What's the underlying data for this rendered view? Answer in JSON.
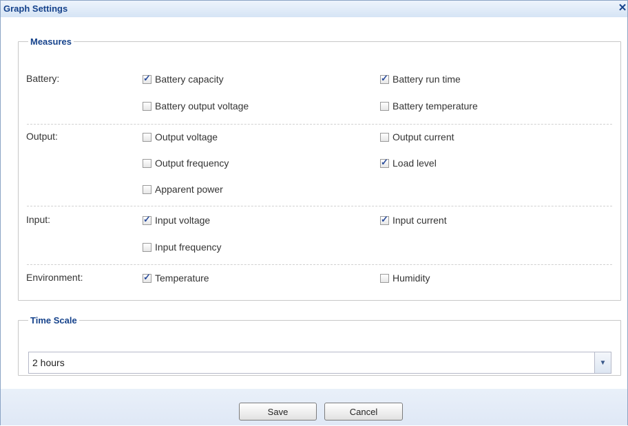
{
  "dialog": {
    "title": "Graph Settings",
    "close_icon": "close-icon",
    "close_glyph": "✕"
  },
  "measures": {
    "legend": "Measures",
    "groups": [
      {
        "label": "Battery:",
        "options": [
          {
            "label": "Battery capacity",
            "checked": true
          },
          {
            "label": "Battery run time",
            "checked": true
          },
          {
            "label": "Battery output voltage",
            "checked": false
          },
          {
            "label": "Battery temperature",
            "checked": false
          }
        ]
      },
      {
        "label": "Output:",
        "options": [
          {
            "label": "Output voltage",
            "checked": false
          },
          {
            "label": "Output current",
            "checked": false
          },
          {
            "label": "Output frequency",
            "checked": false
          },
          {
            "label": "Load level",
            "checked": true
          },
          {
            "label": "Apparent power",
            "checked": false
          }
        ]
      },
      {
        "label": "Input:",
        "options": [
          {
            "label": "Input voltage",
            "checked": true
          },
          {
            "label": "Input current",
            "checked": true
          },
          {
            "label": "Input frequency",
            "checked": false
          }
        ]
      },
      {
        "label": "Environment:",
        "options": [
          {
            "label": "Temperature",
            "checked": true
          },
          {
            "label": "Humidity",
            "checked": false
          }
        ]
      }
    ]
  },
  "time_scale": {
    "legend": "Time Scale",
    "value": "2 hours",
    "dropdown_icon": "chevron-down-icon"
  },
  "buttons": {
    "save": "Save",
    "cancel": "Cancel"
  }
}
